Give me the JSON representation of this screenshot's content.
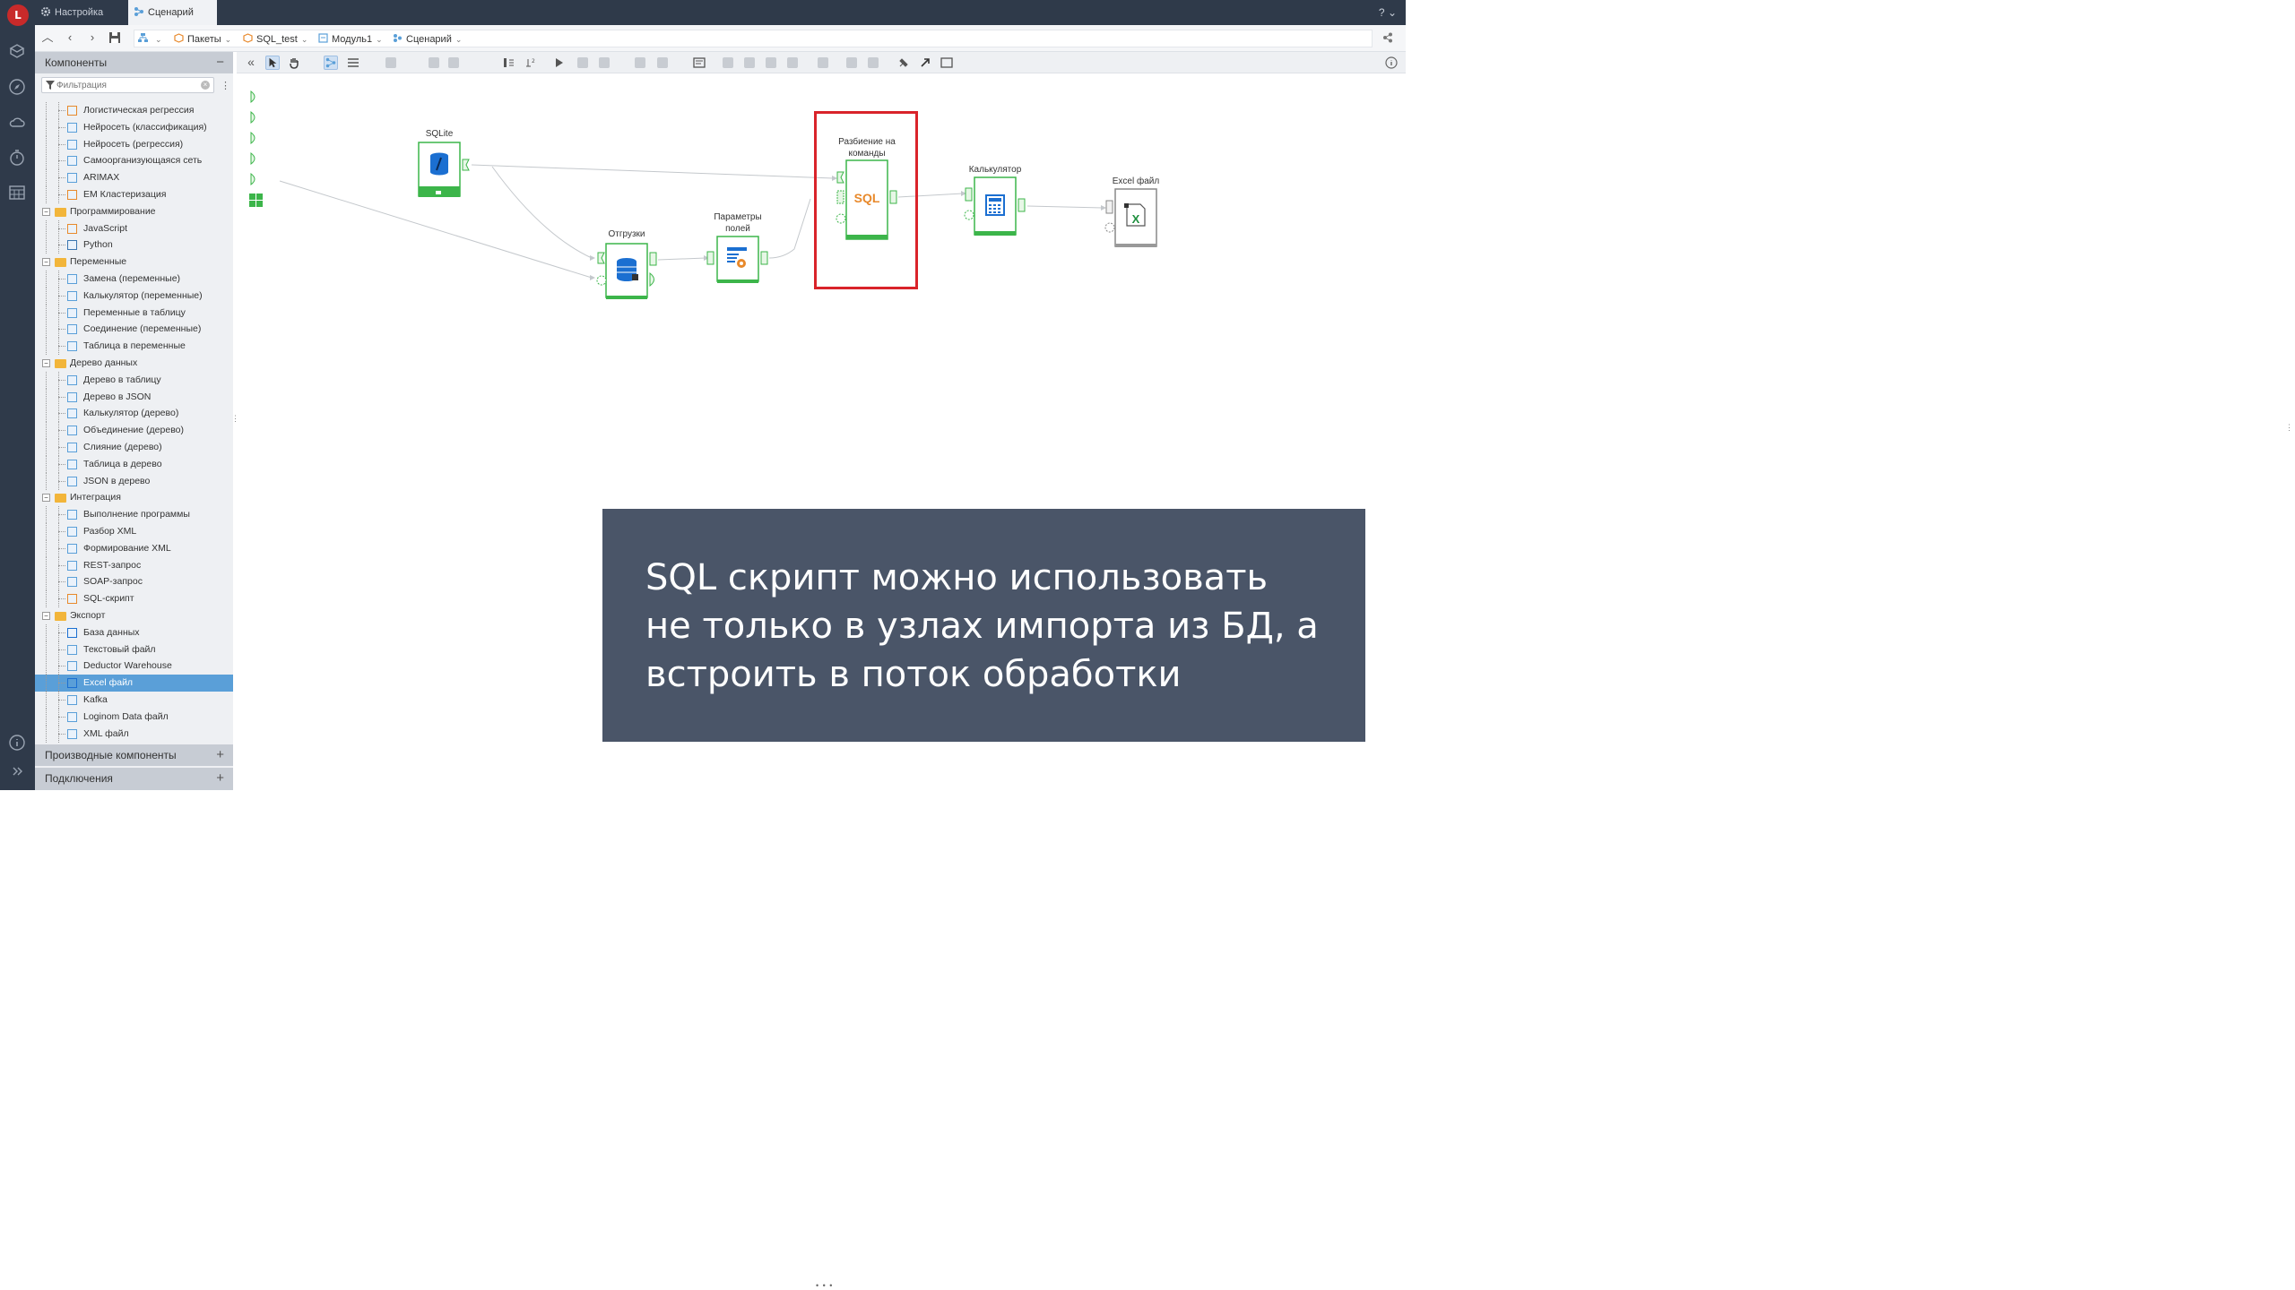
{
  "tabs": [
    {
      "label": "Настройка",
      "icon": "gear-icon"
    },
    {
      "label": "Сценарий",
      "icon": "scenario-icon"
    }
  ],
  "help": "?",
  "breadcrumb": [
    {
      "label": "Пакеты",
      "icon": "package-icon"
    },
    {
      "label": "SQL_test",
      "icon": "package-icon"
    },
    {
      "label": "Модуль1",
      "icon": "module-icon"
    },
    {
      "label": "Сценарий",
      "icon": "scenario-icon"
    }
  ],
  "panel": {
    "components_title": "Компоненты",
    "filter_placeholder": "Фильтрация",
    "derived_title": "Производные компоненты",
    "connections_title": "Подключения",
    "tree": [
      {
        "label": "Логистическая регрессия",
        "level": 2,
        "icon": "regression-icon"
      },
      {
        "label": "Нейросеть (классификация)",
        "level": 2,
        "icon": "neural-icon"
      },
      {
        "label": "Нейросеть (регрессия)",
        "level": 2,
        "icon": "neural-icon"
      },
      {
        "label": "Самоорганизующаяся сеть",
        "level": 2,
        "icon": "som-icon"
      },
      {
        "label": "ARIMAX",
        "level": 2,
        "icon": "arimax-icon"
      },
      {
        "label": "EM Кластеризация",
        "level": 2,
        "icon": "cluster-icon"
      },
      {
        "label": "Программирование",
        "level": 1,
        "icon": "folder-icon"
      },
      {
        "label": "JavaScript",
        "level": 2,
        "icon": "js-icon"
      },
      {
        "label": "Python",
        "level": 2,
        "icon": "python-icon"
      },
      {
        "label": "Переменные",
        "level": 1,
        "icon": "folder-icon"
      },
      {
        "label": "Замена (переменные)",
        "level": 2,
        "icon": "var-icon"
      },
      {
        "label": "Калькулятор (переменные)",
        "level": 2,
        "icon": "calc-icon"
      },
      {
        "label": "Переменные в таблицу",
        "level": 2,
        "icon": "var-icon"
      },
      {
        "label": "Соединение (переменные)",
        "level": 2,
        "icon": "var-icon"
      },
      {
        "label": "Таблица в переменные",
        "level": 2,
        "icon": "var-icon"
      },
      {
        "label": "Дерево данных",
        "level": 1,
        "icon": "folder-icon"
      },
      {
        "label": "Дерево в таблицу",
        "level": 2,
        "icon": "tree-icon"
      },
      {
        "label": "Дерево в JSON",
        "level": 2,
        "icon": "tree-icon"
      },
      {
        "label": "Калькулятор (дерево)",
        "level": 2,
        "icon": "calc-icon"
      },
      {
        "label": "Объединение (дерево)",
        "level": 2,
        "icon": "tree-icon"
      },
      {
        "label": "Слияние (дерево)",
        "level": 2,
        "icon": "tree-icon"
      },
      {
        "label": "Таблица в дерево",
        "level": 2,
        "icon": "tree-icon"
      },
      {
        "label": "JSON в дерево",
        "level": 2,
        "icon": "tree-icon"
      },
      {
        "label": "Интеграция",
        "level": 1,
        "icon": "folder-icon"
      },
      {
        "label": "Выполнение программы",
        "level": 2,
        "icon": "program-icon"
      },
      {
        "label": "Разбор XML",
        "level": 2,
        "icon": "xml-icon"
      },
      {
        "label": "Формирование XML",
        "level": 2,
        "icon": "xml-icon"
      },
      {
        "label": "REST-запрос",
        "level": 2,
        "icon": "rest-icon"
      },
      {
        "label": "SOAP-запрос",
        "level": 2,
        "icon": "soap-icon"
      },
      {
        "label": "SQL-скрипт",
        "level": 2,
        "icon": "sql-icon"
      },
      {
        "label": "Экспорт",
        "level": 1,
        "icon": "folder-icon"
      },
      {
        "label": "База данных",
        "level": 2,
        "icon": "db-icon"
      },
      {
        "label": "Текстовый файл",
        "level": 2,
        "icon": "text-file-icon"
      },
      {
        "label": "Deductor Warehouse",
        "level": 2,
        "icon": "warehouse-icon"
      },
      {
        "label": "Excel файл",
        "level": 2,
        "icon": "excel-icon",
        "selected": true
      },
      {
        "label": "Kafka",
        "level": 2,
        "icon": "kafka-icon"
      },
      {
        "label": "Loginom Data файл",
        "level": 2,
        "icon": "loginom-file-icon"
      },
      {
        "label": "XML файл",
        "level": 2,
        "icon": "xml-file-icon"
      }
    ]
  },
  "nodes": {
    "sqlite": {
      "label": "SQLite"
    },
    "shipments": {
      "label": "Отгрузки"
    },
    "field_params": {
      "label_line1": "Параметры",
      "label_line2": "полей"
    },
    "split": {
      "label_line1": "Разбиение на",
      "label_line2": "команды",
      "icon_text": "SQL"
    },
    "calculator": {
      "label": "Калькулятор"
    },
    "excel": {
      "label": "Excel файл"
    }
  },
  "caption": "SQL скрипт можно использовать не только в узлах импорта из БД, а встроить в поток обработки",
  "colors": {
    "node_green": "#3cb54a",
    "highlight_red": "#d9232a",
    "caption_bg": "#4a5568",
    "selected_row": "#5a9fd8"
  }
}
